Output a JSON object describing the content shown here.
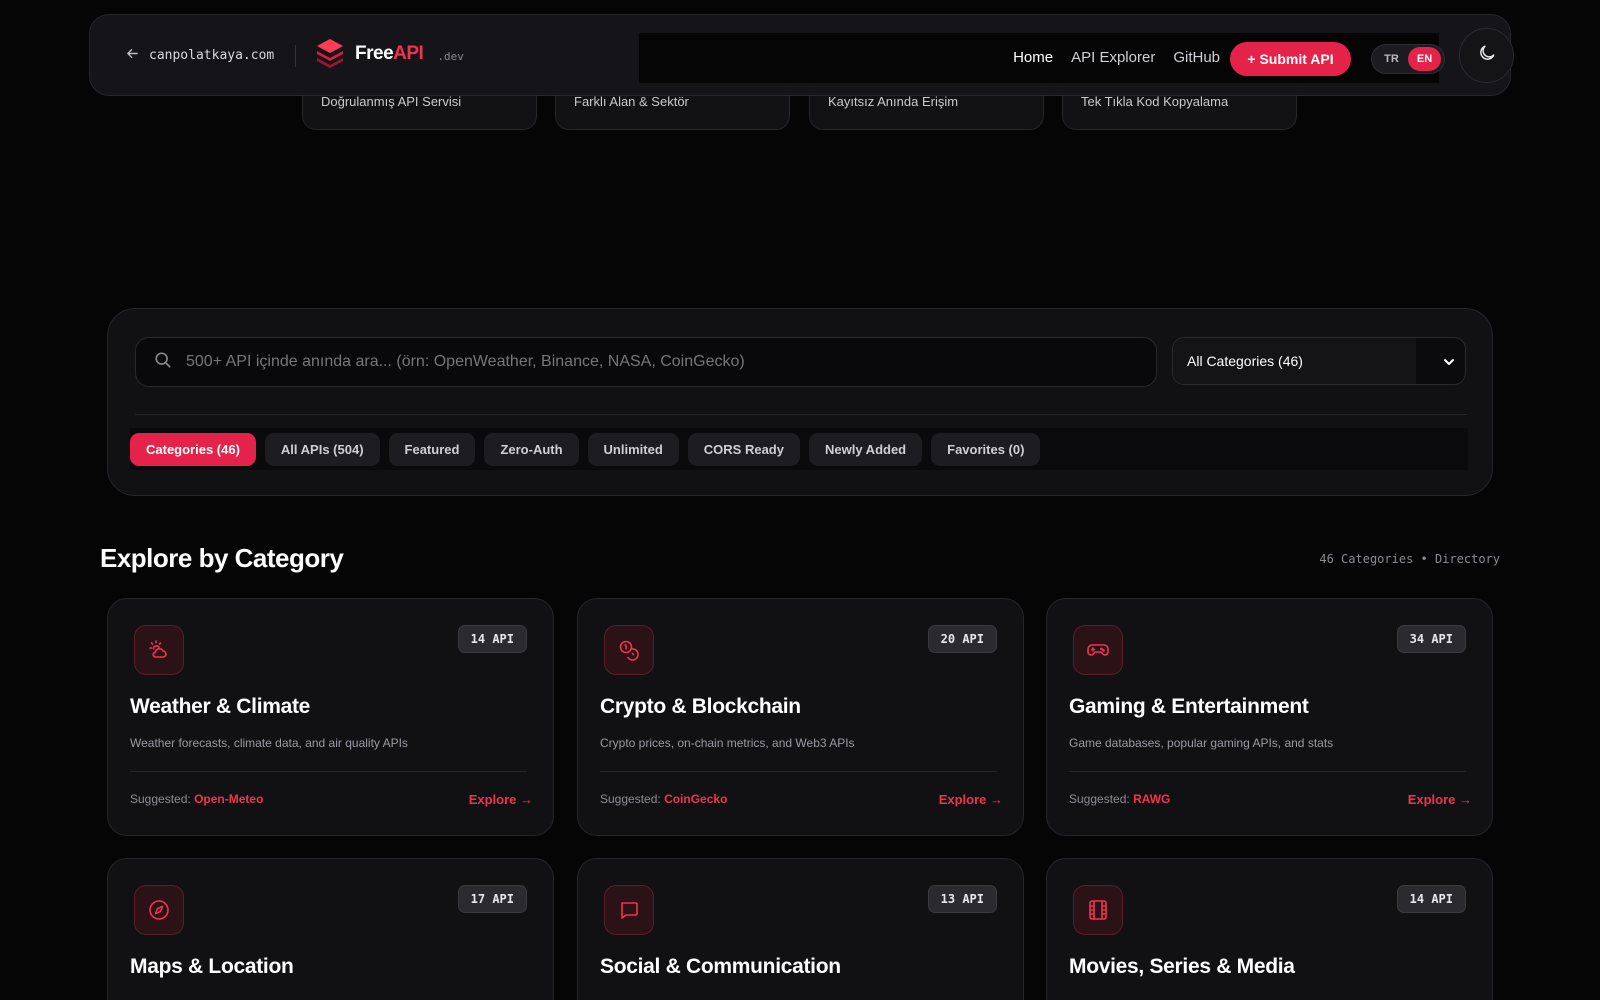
{
  "features": [
    {
      "label": "Doğrulanmış API Servisi"
    },
    {
      "label": "Farklı Alan & Sektör"
    },
    {
      "label": "Kayıtsız Anında Erişim"
    },
    {
      "label": "Tek Tıkla Kod Kopyalama"
    }
  ],
  "header": {
    "back_label": "canpolatkaya.com",
    "logo_main": "Free",
    "logo_accent": "API",
    "logo_tld": ".dev",
    "nav": [
      {
        "label": "Home"
      },
      {
        "label": "API Explorer"
      },
      {
        "label": "GitHub"
      }
    ],
    "submit_label": "+ Submit API",
    "lang_tr": "TR",
    "lang_en": "EN"
  },
  "search": {
    "placeholder": "500+ API içinde anında ara... (örn: OpenWeather, Binance, NASA, CoinGecko)",
    "category_select": "All Categories (46)"
  },
  "filters": [
    {
      "label": "Categories (46)"
    },
    {
      "label": "All APIs (504)"
    },
    {
      "label": "Featured"
    },
    {
      "label": "Zero-Auth"
    },
    {
      "label": "Unlimited"
    },
    {
      "label": "CORS Ready"
    },
    {
      "label": "Newly Added"
    },
    {
      "label": "Favorites (0)"
    }
  ],
  "section": {
    "title": "Explore by Category",
    "meta": "46 Categories • Directory"
  },
  "categories": [
    {
      "title": "Weather & Climate",
      "count": "14 API",
      "desc": "Weather forecasts, climate data, and air quality APIs",
      "suggest_prefix": "Suggested: ",
      "suggest": "Open-Meteo",
      "explore": "Explore →",
      "icon": "weather-icon"
    },
    {
      "title": "Crypto & Blockchain",
      "count": "20 API",
      "desc": "Crypto prices, on-chain metrics, and Web3 APIs",
      "suggest_prefix": "Suggested: ",
      "suggest": "CoinGecko",
      "explore": "Explore →",
      "icon": "coins-icon"
    },
    {
      "title": "Gaming & Entertainment",
      "count": "34 API",
      "desc": "Game databases, popular gaming APIs, and stats",
      "suggest_prefix": "Suggested: ",
      "suggest": "RAWG",
      "explore": "Explore →",
      "icon": "gamepad-icon"
    },
    {
      "title": "Maps & Location",
      "count": "17 API",
      "icon": "compass-icon"
    },
    {
      "title": "Social & Communication",
      "count": "13 API",
      "icon": "chat-icon"
    },
    {
      "title": "Movies, Series & Media",
      "count": "14 API",
      "icon": "film-icon"
    }
  ],
  "colors": {
    "accent": "#e5234a",
    "background": "#050506",
    "card": "#111114"
  }
}
